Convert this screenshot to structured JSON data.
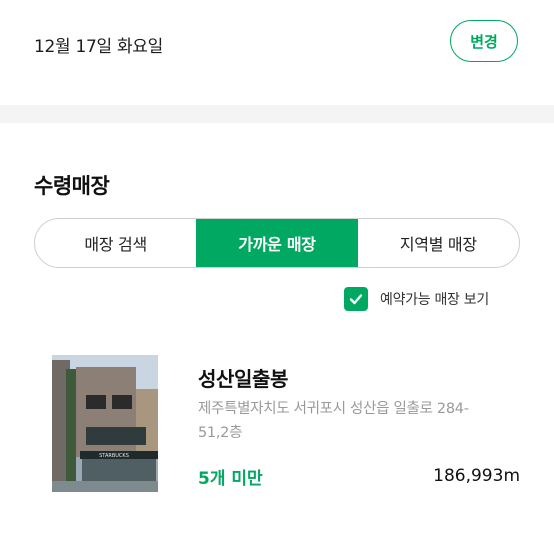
{
  "date_row": {
    "date": "12월 17일 화요일",
    "change_label": "변경"
  },
  "section": {
    "title": "수령매장"
  },
  "tabs": [
    {
      "label": "매장 검색",
      "active": false
    },
    {
      "label": "가까운 매장",
      "active": true
    },
    {
      "label": "지역별 매장",
      "active": false
    }
  ],
  "filter": {
    "label": "예약가능 매장 보기",
    "checked": true
  },
  "store": {
    "name": "성산일출봉",
    "address": "제주특별자치도 서귀포시 성산읍 일출로 284-51,2층",
    "availability": "5개 미만",
    "distance": "186,993m",
    "photo_sign": "STARBUCKS"
  },
  "colors": {
    "accent": "#00a862",
    "divider": "#f4f4f4",
    "border": "#cfcfcf"
  }
}
